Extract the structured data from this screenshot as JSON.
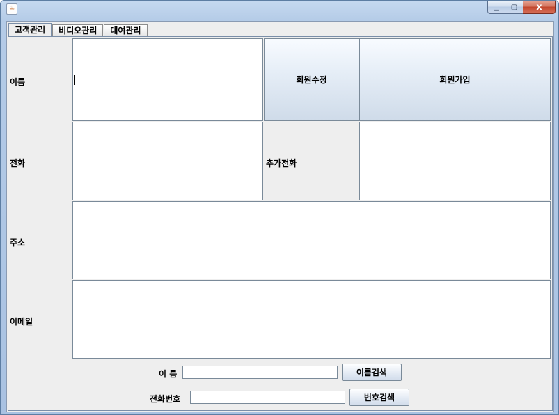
{
  "window": {
    "icon": "java-icon",
    "controls": {
      "minimize": "minimize-icon",
      "maximize": "maximize-icon",
      "close": "close-icon",
      "close_glyph": "x"
    }
  },
  "tabs": [
    {
      "label": "고객관리",
      "active": true
    },
    {
      "label": "비디오관리",
      "active": false
    },
    {
      "label": "대여관리",
      "active": false
    }
  ],
  "form": {
    "name_label": "이름",
    "phone_label": "전화",
    "extra_phone_label": "추가전화",
    "address_label": "주소",
    "email_label": "이메일",
    "name_value": "",
    "phone_value": "",
    "extra_phone_value": "",
    "address_value": "",
    "email_value": "",
    "edit_button": "회원수정",
    "join_button": "회원가입"
  },
  "search": {
    "name_label": "이 름",
    "name_value": "",
    "name_button": "이름검색",
    "phone_label": "전화번호",
    "phone_value": "",
    "phone_button": "번호검색"
  }
}
